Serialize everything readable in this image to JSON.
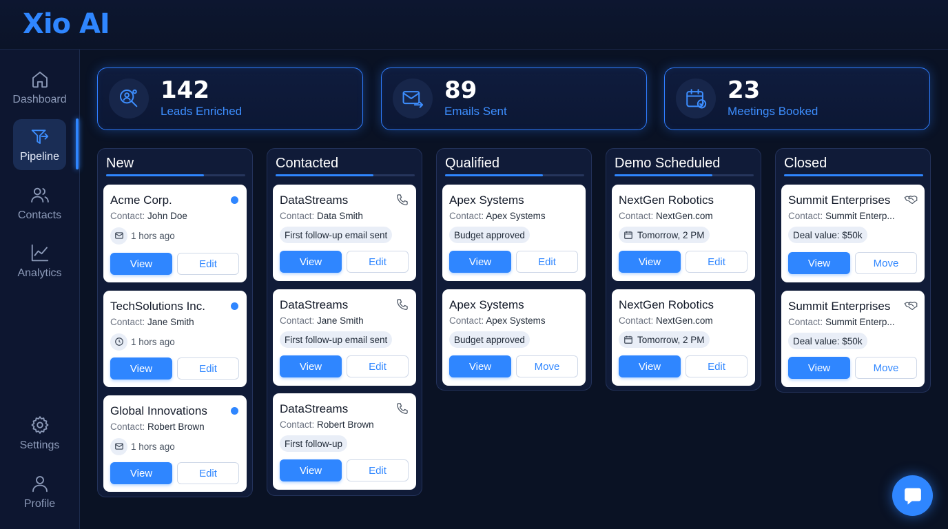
{
  "app": {
    "logo_x": "Xio",
    "logo_ai": "AI"
  },
  "sidebar": {
    "items": [
      {
        "label": "Dashboard",
        "icon": "home-icon"
      },
      {
        "label": "Pipeline",
        "icon": "pipeline-icon",
        "active": true
      },
      {
        "label": "Contacts",
        "icon": "users-icon"
      },
      {
        "label": "Analytics",
        "icon": "chart-line-icon"
      },
      {
        "label": "Settings",
        "icon": "gear-icon"
      },
      {
        "label": "Profile",
        "icon": "user-icon"
      }
    ]
  },
  "stats": [
    {
      "value": "142",
      "label": "Leads Enriched",
      "icon": "user-search-icon"
    },
    {
      "value": "89",
      "label": "Emails Sent",
      "icon": "mail-send-icon"
    },
    {
      "value": "23",
      "label": "Meetings Booked",
      "icon": "calendar-check-icon"
    }
  ],
  "columns": [
    {
      "title": "New",
      "cards": [
        {
          "name": "Acme Corp.",
          "contact_prefix": "Contact:",
          "contact": "John Doe",
          "meta": "1 hors ago",
          "meta_icon": "mail-icon",
          "primary": "View",
          "secondary": "Edit"
        },
        {
          "name": "TechSolutions Inc.",
          "contact_prefix": "Contact:",
          "contact": "Jane Smith",
          "meta": "1 hors ago",
          "meta_icon": "clock-icon",
          "primary": "View",
          "secondary": "Edit"
        },
        {
          "name": "Global Innovations",
          "contact_prefix": "Contact:",
          "contact": "Robert Brown",
          "meta": "1 hors ago",
          "meta_icon": "mail-icon",
          "primary": "View",
          "secondary": "Edit"
        }
      ]
    },
    {
      "title": "Contacted",
      "cards": [
        {
          "name": "DataStreams",
          "contact_prefix": "Contact:",
          "contact": "Data Smith",
          "meta": "First follow-up email sent",
          "primary": "View",
          "secondary": "Edit"
        },
        {
          "name": "DataStreams",
          "contact_prefix": "Contact:",
          "contact": "Jane Smith",
          "meta": "First follow-up email sent",
          "primary": "View",
          "secondary": "Edit"
        },
        {
          "name": "DataStreams",
          "contact_prefix": "Contact:",
          "contact": "Robert Brown",
          "meta": "First follow-up",
          "primary": "View",
          "secondary": "Edit"
        }
      ]
    },
    {
      "title": "Qualified",
      "cards": [
        {
          "name": "Apex Systems",
          "contact_prefix": "Contact:",
          "contact": "Apex Systems",
          "meta": "Budget approved",
          "primary": "View",
          "secondary": "Edit"
        },
        {
          "name": "Apex Systems",
          "contact_prefix": "Contact:",
          "contact": "Apex Systems",
          "meta": "Budget approved",
          "primary": "View",
          "secondary": "Move"
        }
      ]
    },
    {
      "title": "Demo Scheduled",
      "cards": [
        {
          "name": "NextGen Robotics",
          "contact_prefix": "Contact:",
          "contact": "NextGen.com",
          "meta": "Tomorrow, 2 PM",
          "primary": "View",
          "secondary": "Edit"
        },
        {
          "name": "NextGen Robotics",
          "contact_prefix": "Contact:",
          "contact": "NextGen.com",
          "meta": "Tomorrow, 2 PM",
          "primary": "View",
          "secondary": "Edit"
        }
      ]
    },
    {
      "title": "Closed",
      "cards": [
        {
          "name": "Summit Enterprises",
          "contact_prefix": "Contact:",
          "contact": "Summit Enterp...",
          "meta": "Deal value: $50k",
          "primary": "View",
          "secondary": "Move"
        },
        {
          "name": "Summit Enterprises",
          "contact_prefix": "Contact:",
          "contact": "Summit Enterp...",
          "meta": "Deal value: $50k",
          "primary": "View",
          "secondary": "Move"
        }
      ]
    }
  ],
  "chat": {
    "icon": "chat-icon"
  },
  "colors": {
    "accent": "#2f86ff",
    "background": "#0a1224"
  }
}
